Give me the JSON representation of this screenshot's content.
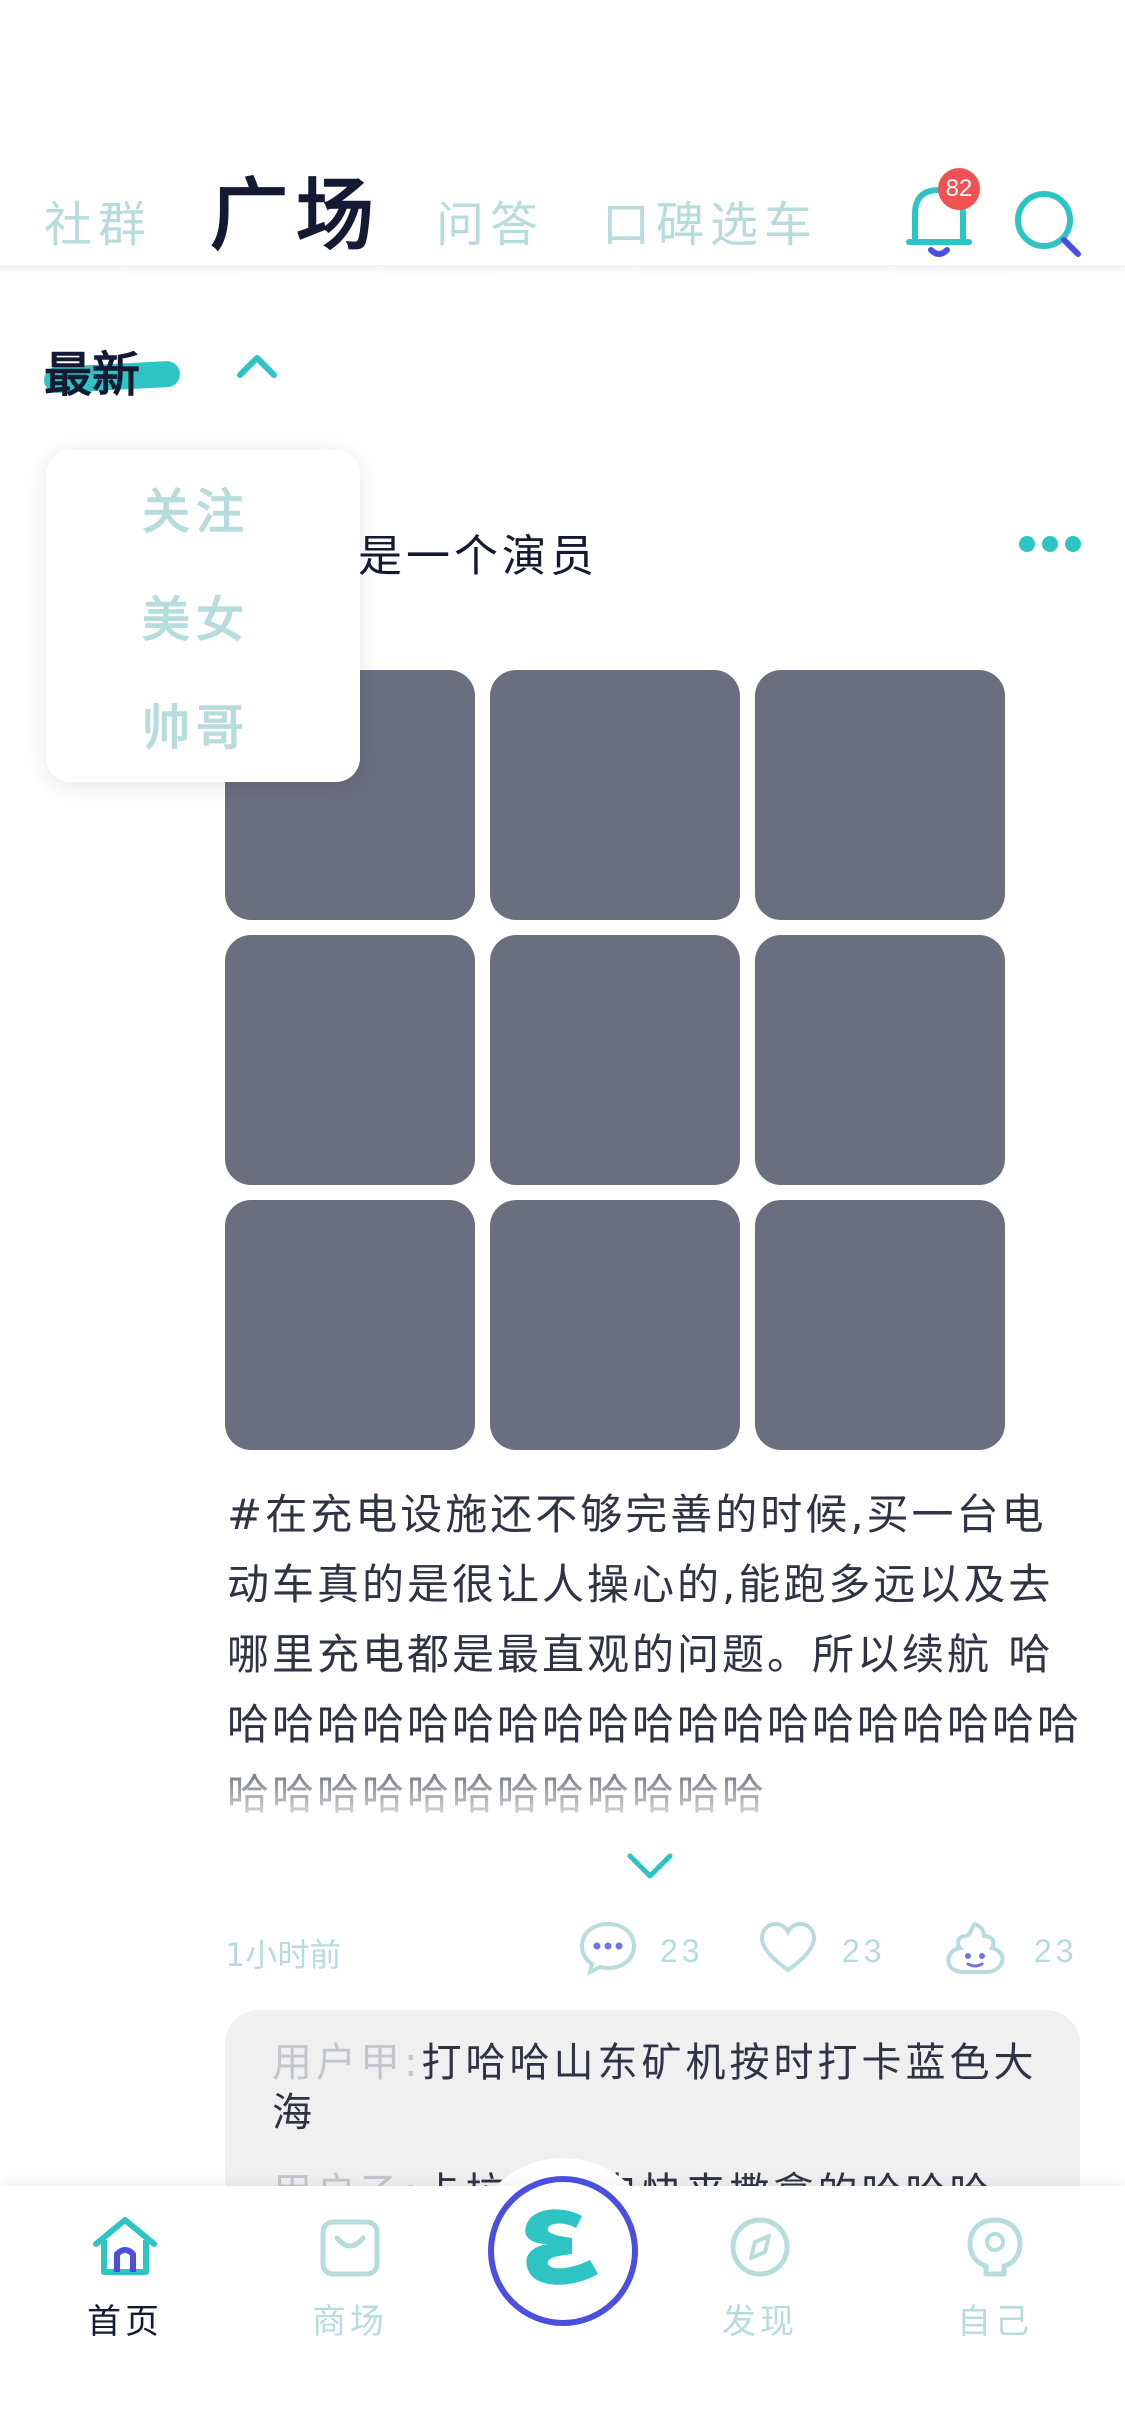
{
  "tabs": [
    "社群",
    "广场",
    "问答",
    "口碑选车"
  ],
  "active_tab": "广场",
  "notifications": {
    "badge": "82"
  },
  "filter": {
    "selected": "最新",
    "options": [
      "关注",
      "美女",
      "帅哥"
    ]
  },
  "post": {
    "author": "我是一个演员",
    "content": "#在充电设施还不够完善的时候,买一台电动车真的是很让人操心的,能跑多远以及去哪里充电都是最直观的问题。所以续航 哈哈哈哈哈哈哈哈哈哈哈哈哈哈哈哈哈哈哈哈哈哈哈哈哈哈哈哈哈哈哈哈",
    "time": "1小时前",
    "stats": {
      "comments": "23",
      "likes": "23",
      "poop": "23"
    },
    "comments": [
      {
        "user": "用户甲:",
        "text": "打哈哈山东矿机按时打卡蓝色大海"
      },
      {
        "user": "用户乙:",
        "text": "卡拉斯家电快来撒拿的哈哈哈"
      }
    ]
  },
  "bottom_nav": [
    {
      "label": "首页"
    },
    {
      "label": "商场"
    },
    {
      "label": "发现"
    },
    {
      "label": "自己"
    }
  ],
  "colors": {
    "accent": "#2ec4c4",
    "inactive": "#b7dcdc",
    "dark": "#141a33",
    "badge": "#f05252",
    "logo_ring": "#4a4fe0"
  }
}
